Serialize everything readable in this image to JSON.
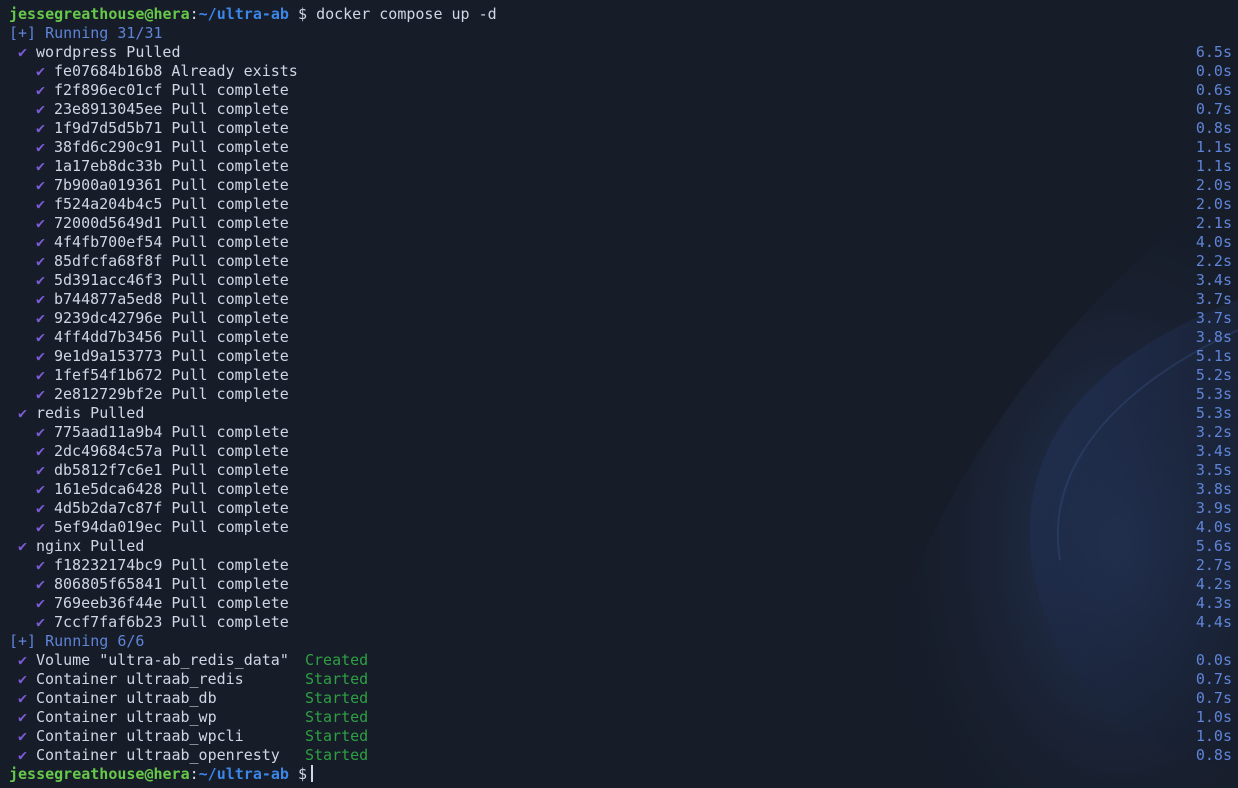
{
  "prompt_top": {
    "user_host": "jessegreathouse@hera",
    "colon": ":",
    "path": "~/ultra-ab",
    "dollar": "$",
    "command": "docker compose up -d"
  },
  "check_glyph": "✔",
  "pull_running": "[+] Running 31/31",
  "pulls": [
    {
      "name": "wordpress Pulled",
      "duration": "6.5s",
      "layers": [
        {
          "text": "fe07684b16b8 Already exists",
          "duration": "0.0s"
        },
        {
          "text": "f2f896ec01cf Pull complete",
          "duration": "0.6s"
        },
        {
          "text": "23e8913045ee Pull complete",
          "duration": "0.7s"
        },
        {
          "text": "1f9d7d5d5b71 Pull complete",
          "duration": "0.8s"
        },
        {
          "text": "38fd6c290c91 Pull complete",
          "duration": "1.1s"
        },
        {
          "text": "1a17eb8dc33b Pull complete",
          "duration": "1.1s"
        },
        {
          "text": "7b900a019361 Pull complete",
          "duration": "2.0s"
        },
        {
          "text": "f524a204b4c5 Pull complete",
          "duration": "2.0s"
        },
        {
          "text": "72000d5649d1 Pull complete",
          "duration": "2.1s"
        },
        {
          "text": "4f4fb700ef54 Pull complete",
          "duration": "4.0s"
        },
        {
          "text": "85dfcfa68f8f Pull complete",
          "duration": "2.2s"
        },
        {
          "text": "5d391acc46f3 Pull complete",
          "duration": "3.4s"
        },
        {
          "text": "b744877a5ed8 Pull complete",
          "duration": "3.7s"
        },
        {
          "text": "9239dc42796e Pull complete",
          "duration": "3.7s"
        },
        {
          "text": "4ff4dd7b3456 Pull complete",
          "duration": "3.8s"
        },
        {
          "text": "9e1d9a153773 Pull complete",
          "duration": "5.1s"
        },
        {
          "text": "1fef54f1b672 Pull complete",
          "duration": "5.2s"
        },
        {
          "text": "2e812729bf2e Pull complete",
          "duration": "5.3s"
        }
      ]
    },
    {
      "name": "redis Pulled",
      "duration": "5.3s",
      "layers": [
        {
          "text": "775aad11a9b4 Pull complete",
          "duration": "3.2s"
        },
        {
          "text": "2dc49684c57a Pull complete",
          "duration": "3.4s"
        },
        {
          "text": "db5812f7c6e1 Pull complete",
          "duration": "3.5s"
        },
        {
          "text": "161e5dca6428 Pull complete",
          "duration": "3.8s"
        },
        {
          "text": "4d5b2da7c87f Pull complete",
          "duration": "3.9s"
        },
        {
          "text": "5ef94da019ec Pull complete",
          "duration": "4.0s"
        }
      ]
    },
    {
      "name": "nginx Pulled",
      "duration": "5.6s",
      "layers": [
        {
          "text": "f18232174bc9 Pull complete",
          "duration": "2.7s"
        },
        {
          "text": "806805f65841 Pull complete",
          "duration": "4.2s"
        },
        {
          "text": "769eeb36f44e Pull complete",
          "duration": "4.3s"
        },
        {
          "text": "7ccf7faf6b23 Pull complete",
          "duration": "4.4s"
        }
      ]
    }
  ],
  "create_running": "[+] Running 6/6",
  "resources": [
    {
      "name": "Volume \"ultra-ab_redis_data\"",
      "state": "Created",
      "duration": "0.0s"
    },
    {
      "name": "Container ultraab_redis",
      "state": "Started",
      "duration": "0.7s"
    },
    {
      "name": "Container ultraab_db",
      "state": "Started",
      "duration": "0.7s"
    },
    {
      "name": "Container ultraab_wp",
      "state": "Started",
      "duration": "1.0s"
    },
    {
      "name": "Container ultraab_wpcli",
      "state": "Started",
      "duration": "1.0s"
    },
    {
      "name": "Container ultraab_openresty",
      "state": "Started",
      "duration": "0.8s"
    }
  ],
  "prompt_bottom": {
    "user_host": "jessegreathouse@hera",
    "colon": ":",
    "path": "~/ultra-ab",
    "dollar": "$"
  },
  "colors": {
    "background": "#161c28",
    "text": "#cfd6e4",
    "user": "#66c94a",
    "path": "#3c86e8",
    "check": "#7c5bd6",
    "duration": "#5f84d8",
    "state": "#2ea043"
  }
}
